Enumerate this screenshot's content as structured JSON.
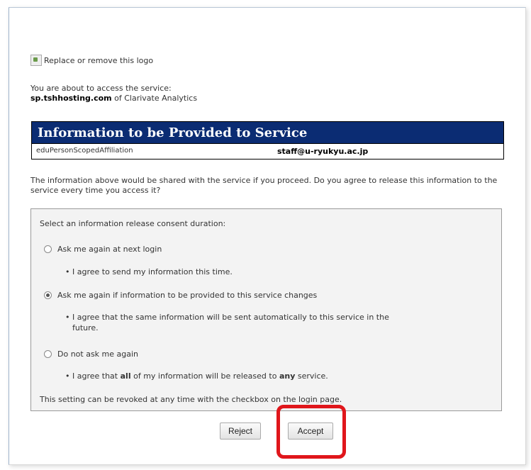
{
  "logo": {
    "alt_text": "Replace or remove this logo"
  },
  "intro": {
    "line1": "You are about to access the service:",
    "service_host": "sp.tshhosting.com",
    "service_of": " of Clarivate Analytics"
  },
  "info": {
    "header": "Information to be Provided to Service",
    "rows": [
      {
        "attribute": "eduPersonScopedAffiliation",
        "value": "staff@u-ryukyu.ac.jp"
      }
    ]
  },
  "question": "The information above would be shared with the service if you proceed. Do you agree to release this information to the service every time you access it?",
  "consent": {
    "title": "Select an information release consent duration:",
    "options": [
      {
        "label": "Ask me again at next login",
        "checked": false,
        "desc": "I agree to send my information this time."
      },
      {
        "label": "Ask me again if information to be provided to this service changes",
        "checked": true,
        "desc_line1": "I agree that the same information will be sent automatically to this service in the",
        "desc_line2": "future."
      },
      {
        "label": "Do not ask me again",
        "checked": false,
        "desc_pre": "I agree that ",
        "desc_all": "all",
        "desc_mid": " of my information will be released to ",
        "desc_any": "any",
        "desc_post": " service."
      }
    ],
    "footnote": "This setting can be revoked at any time with the checkbox on the login page."
  },
  "buttons": {
    "reject": "Reject",
    "accept": "Accept"
  },
  "colors": {
    "header_bg": "#0b2c73",
    "highlight": "#e0161b"
  }
}
